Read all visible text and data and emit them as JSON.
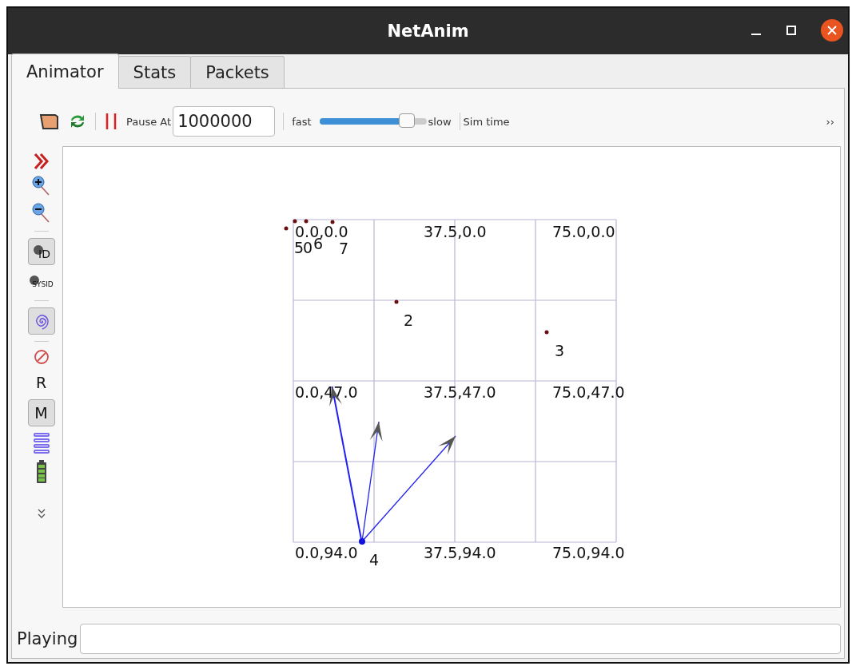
{
  "window": {
    "title": "NetAnim"
  },
  "tabs": [
    {
      "label": "Animator",
      "selected": true
    },
    {
      "label": "Stats",
      "selected": false
    },
    {
      "label": "Packets",
      "selected": false
    }
  ],
  "toolbar": {
    "pause_label": "Pause At",
    "pause_value": "1000000",
    "fast_label": "fast",
    "slow_label": "slow",
    "speed": {
      "level": 0.82
    },
    "sim_time_label": "Sim time",
    "overflow": "››"
  },
  "side_tools": [
    {
      "kind": "fast-forward"
    },
    {
      "kind": "zoom-in"
    },
    {
      "kind": "zoom-out"
    },
    {
      "kind": "separator"
    },
    {
      "kind": "id",
      "label": "ID",
      "pressed": true
    },
    {
      "kind": "sysid",
      "label": "SYSID",
      "pressed": false
    },
    {
      "kind": "separator"
    },
    {
      "kind": "spiral",
      "pressed": true
    },
    {
      "kind": "separator"
    },
    {
      "kind": "blocked"
    },
    {
      "kind": "letter",
      "label": "R",
      "pressed": false
    },
    {
      "kind": "letter",
      "label": "M",
      "pressed": true
    },
    {
      "kind": "lines"
    },
    {
      "kind": "battery"
    },
    {
      "kind": "more"
    }
  ],
  "grid_labels": [
    "0.0,0.0",
    "37.5,0.0",
    "75.0,0.0",
    "0.0,47.0",
    "37.5,47.0",
    "75.0,47.0",
    "0.0,94.0",
    "37.5,94.0",
    "75.0,94.0"
  ],
  "nodes": [
    {
      "label": "5"
    },
    {
      "label": "0"
    },
    {
      "label": "6"
    },
    {
      "label": "7"
    },
    {
      "label": "2"
    },
    {
      "label": "3"
    },
    {
      "label": "4"
    }
  ],
  "status": {
    "label": "Playing"
  }
}
